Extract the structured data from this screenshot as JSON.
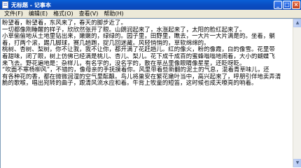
{
  "window": {
    "title": "无标题 - 记事本",
    "buttons": {
      "minimize": "_",
      "maximize": "□",
      "close": "×"
    }
  },
  "menu": [
    "文件(F)",
    "编辑(E)",
    "格式(O)",
    "查看(V)",
    "帮助(H)"
  ],
  "document": {
    "lines": [
      "盼望着，盼望着，东风来了，春天的脚步近了。",
      "一切都像刚睡醒的样子，欣欣然张开了眼。山朗润起来了，水涨起来了，太阳的脸红起来了。",
      "小草偷偷地从土地里钻出来，嫩嫩的，绿绿的。园子里，田野里，瞧去，一大片一大片满是的。坐着，躺",
      "着，打两个滚，踢几脚球，赛几趟跑，捉几回迷藏。风轻悄悄的，草软绵绵的。",
      "桃树、杏树、梨树，你不让我，我不让你，都开满了花赶趟儿。红的像火，粉的像霞，白的像雪。花里带",
      "着甜味，闭了眼，树上仿佛已经满是桃儿、杏儿、梨儿。花下成千成百的蜜蜂嗡嗡地闹着，大小的蝴蝶飞",
      "来飞去。野花遍地是：杂样儿，有名字的，没名字的，散在草丛里像眼睛像星星，还眨呀眨。",
      "“吹面不寒杨柳风”，不错的，像母亲的手抚摸着你。风里带着些新翻的泥土的气息，混着青草味儿，还",
      "有各种花的香，都在微微润湿的空气里酝酿。鸟儿将巢安在繁花嫩叶当中，高兴起来了，呼朋引伴地卖弄清",
      "脆的歌喉，唱出宛转的曲子，跟清风流水应和着。牛背上牧童的短笛，这时候也成天嘹亮的响着。"
    ]
  },
  "icons": {
    "app": "notepad-icon",
    "scroll_up": "scroll-up-arrow-icon",
    "scroll_down": "scroll-down-arrow-icon"
  },
  "colors": {
    "titlebar": "#0a4fc4",
    "close_button": "#c1401e",
    "window_bg": "#ece9d8",
    "editor_bg": "#ffffff"
  }
}
